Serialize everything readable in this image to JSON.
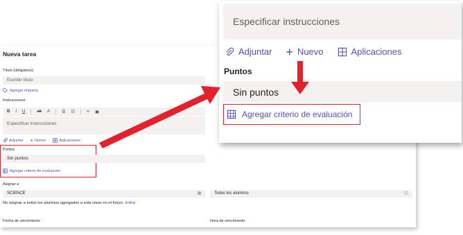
{
  "form": {
    "title": "Nueva tarea",
    "title_label": "Título (obligatorio)",
    "title_placeholder": "Escribir título",
    "add_tag": "Agregar etiqueta",
    "instructions_label": "Instrucciones",
    "instructions_placeholder": "Especificar instrucciones",
    "attach": "Adjuntar",
    "new": "Nuevo",
    "apps": "Aplicaciones",
    "points_label": "Puntos",
    "points_value": "Sin puntos",
    "rubric": "Agregar criterio de evaluación",
    "assign_label": "Asignar a",
    "class_value": "SCIENCE",
    "students_value": "Todos los alumnos",
    "notice_text": "No asignar a todos los alumnos agregados a esta clase en el futuro.",
    "notice_edit": "Editar",
    "due_date_label": "Fecha de vencimiento",
    "due_time_label": "Hora de vencimiento"
  },
  "toolbar_icons": [
    "bold-icon",
    "italic-icon",
    "underline-icon",
    "strikethrough-icon",
    "highlight-icon",
    "bullet-list-icon",
    "numbered-list-icon",
    "link-icon",
    "image-icon"
  ],
  "zoom": {
    "instructions_placeholder": "Especificar instrucciones",
    "attach": "Adjuntar",
    "new": "Nuevo",
    "apps": "Aplicaciones",
    "points_label": "Puntos",
    "points_value": "Sin puntos",
    "rubric": "Agregar criterio de evaluación"
  },
  "colors": {
    "accent": "#4f52b2",
    "highlight": "#e3202b",
    "field_bg": "#f3f2f1"
  }
}
